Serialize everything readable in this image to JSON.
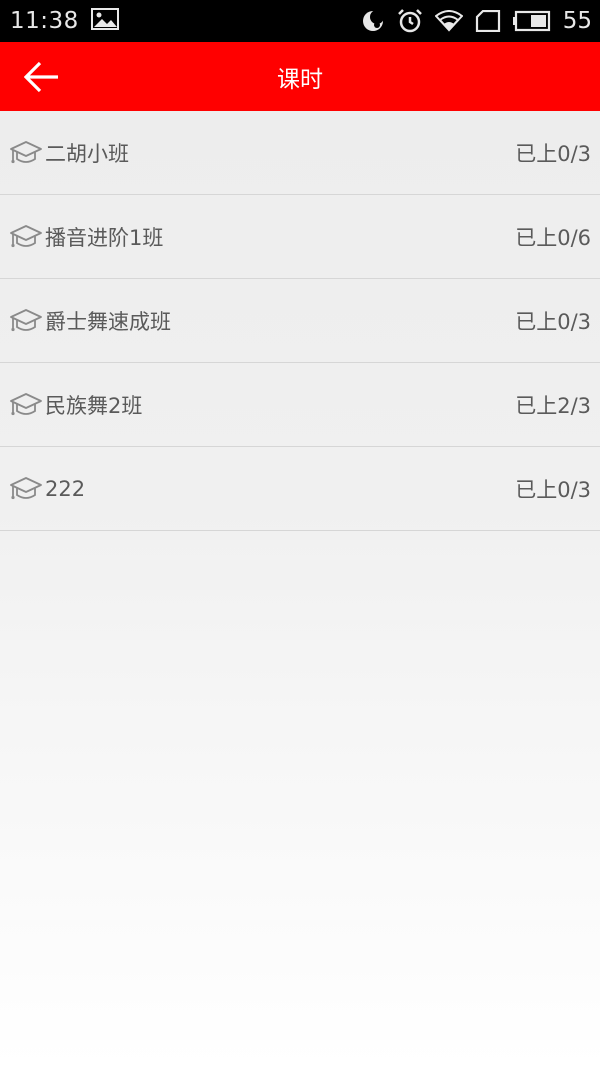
{
  "status_bar": {
    "time": "11:38",
    "battery_level": "55",
    "icons": [
      "image-icon",
      "moon-icon",
      "alarm-icon",
      "wifi-icon",
      "sim-icon",
      "battery-icon"
    ]
  },
  "header": {
    "title": "课时",
    "back_icon": "arrow-left-icon",
    "background_color": "#ff0000"
  },
  "courses": [
    {
      "name": "二胡小班",
      "progress": "已上0/3"
    },
    {
      "name": "播音进阶1班",
      "progress": "已上0/6"
    },
    {
      "name": "爵士舞速成班",
      "progress": "已上0/3"
    },
    {
      "name": "民族舞2班",
      "progress": "已上2/3"
    },
    {
      "name": "222",
      "progress": "已上0/3"
    }
  ]
}
